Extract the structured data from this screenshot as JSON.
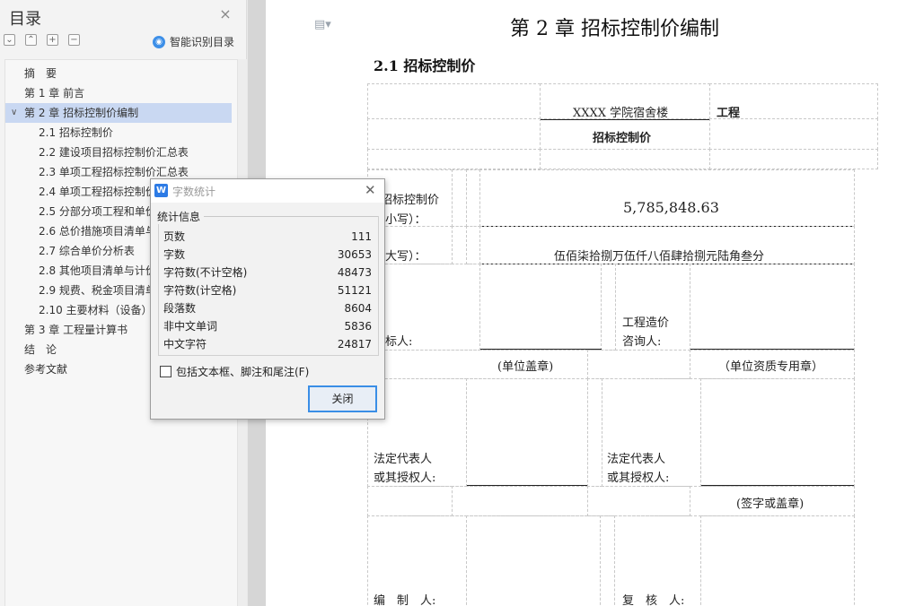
{
  "sidebar": {
    "title": "目录",
    "smart_toc_label": "智能识别目录",
    "items": [
      {
        "label": "摘　要",
        "level": 1
      },
      {
        "label": "第 1 章 前言",
        "level": 1
      },
      {
        "label": "第 2 章  招标控制价编制",
        "level": 1,
        "active": true,
        "expanded": true
      },
      {
        "label": "2.1 招标控制价",
        "level": 2
      },
      {
        "label": "2.2 建设项目招标控制价汇总表",
        "level": 2
      },
      {
        "label": "2.3 单项工程招标控制价汇总表",
        "level": 2
      },
      {
        "label": "2.4 单项工程招标控制价",
        "level": 2
      },
      {
        "label": "2.5 分部分项工程和单价",
        "level": 2
      },
      {
        "label": "2.6 总价措施项目清单与",
        "level": 2
      },
      {
        "label": "2.7 综合单价分析表",
        "level": 2
      },
      {
        "label": "2.8 其他项目清单与计价",
        "level": 2
      },
      {
        "label": "2.9 规费、税金项目清单",
        "level": 2
      },
      {
        "label": "2.10 主要材料（设备）",
        "level": 2
      },
      {
        "label": "第 3 章  工程量计算书",
        "level": 1
      },
      {
        "label": "结　论",
        "level": 1
      },
      {
        "label": "参考文献",
        "level": 1
      }
    ]
  },
  "document": {
    "chapter_title": "第 2 章  招标控制价编制",
    "section_title": "2.1 招标控制价",
    "project_name": "XXXX 学院宿舍楼",
    "project_suffix": "工程",
    "doc_name": "招标控制价",
    "price_small_label_1": "招标控制价",
    "price_small_label_2": "（小写）：",
    "price_small_value": "5,785,848.63",
    "price_big_label": "（大写）：",
    "price_big_value": "伍佰柒拾捌万伍仟八佰肆拾捌元陆角叁分",
    "tenderer_label": "招标人:",
    "consultant_label_1": "工程造价",
    "consultant_label_2": "咨询人:",
    "seal_unit": "(单位盖章)",
    "seal_qualification": "（单位资质专用章）",
    "legal_rep_1": "法定代表人",
    "legal_rep_2": "或其授权人:",
    "sign_or_seal": "(签字或盖章)",
    "compiler_label": "编　制　人:",
    "reviewer_label": "复　核　人:"
  },
  "dialog": {
    "title": "字数统计",
    "group_label": "统计信息",
    "stats": [
      {
        "label": "页数",
        "value": "111"
      },
      {
        "label": "字数",
        "value": "30653"
      },
      {
        "label": "字符数(不计空格)",
        "value": "48473"
      },
      {
        "label": "字符数(计空格)",
        "value": "51121"
      },
      {
        "label": "段落数",
        "value": "8604"
      },
      {
        "label": "非中文单词",
        "value": "5836"
      },
      {
        "label": "中文字符",
        "value": "24817"
      }
    ],
    "include_checkbox_label": "包括文本框、脚注和尾注(F)",
    "include_checked": false,
    "close_button_label": "关闭"
  }
}
